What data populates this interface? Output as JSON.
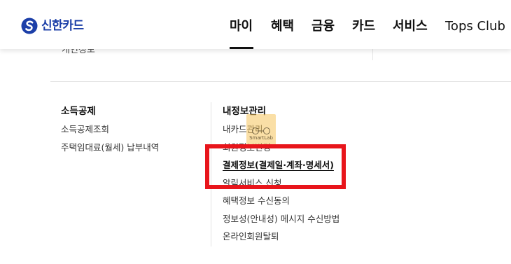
{
  "brand": {
    "name": "신한카드",
    "color": "#1c3fa8",
    "icon": "shinhan-s-logo-icon"
  },
  "gnb": {
    "items": [
      {
        "label": "마이",
        "active": true
      },
      {
        "label": "혜택"
      },
      {
        "label": "금융"
      },
      {
        "label": "카드"
      },
      {
        "label": "서비스"
      },
      {
        "label": "Tops Club"
      }
    ]
  },
  "top_strip": {
    "cut_text": "개인정보"
  },
  "columns": {
    "left": {
      "title": "소득공제",
      "items": [
        {
          "label": "소득공제조회"
        },
        {
          "label": "주택임대료(월세) 납부내역"
        }
      ]
    },
    "right": {
      "title": "내정보관리",
      "items": [
        {
          "label": "내카드관리"
        },
        {
          "label": "회원정보변경"
        },
        {
          "label": "결제정보(결제일·계좌·명세서)",
          "active": true
        },
        {
          "label": "알림서비스 신청"
        },
        {
          "label": "혜택정보 수신동의"
        },
        {
          "label": "정보성(안내성) 메시지 수신방법"
        },
        {
          "label": "온라인회원탈퇴"
        }
      ]
    }
  },
  "watermark": {
    "text": "SmartLab",
    "icon": "glasses-icon"
  },
  "highlight": {
    "color": "#e8151b",
    "target": "결제정보(결제일·계좌·명세서)"
  }
}
